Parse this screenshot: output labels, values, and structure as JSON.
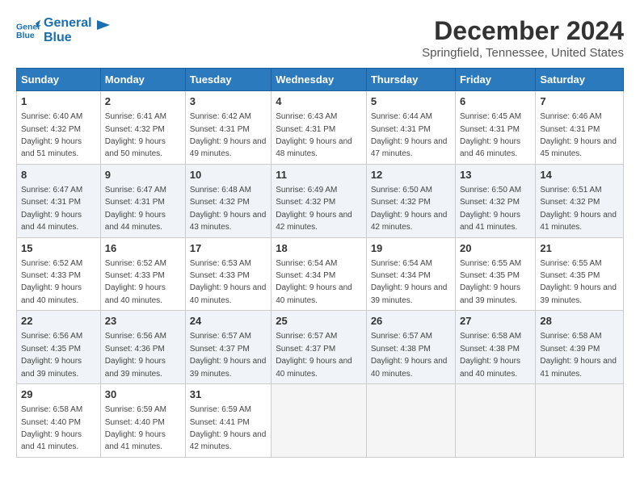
{
  "header": {
    "logo_line1": "General",
    "logo_line2": "Blue",
    "main_title": "December 2024",
    "subtitle": "Springfield, Tennessee, United States"
  },
  "days_of_week": [
    "Sunday",
    "Monday",
    "Tuesday",
    "Wednesday",
    "Thursday",
    "Friday",
    "Saturday"
  ],
  "weeks": [
    [
      {
        "day": "1",
        "sunrise": "6:40 AM",
        "sunset": "4:32 PM",
        "daylight": "9 hours and 51 minutes."
      },
      {
        "day": "2",
        "sunrise": "6:41 AM",
        "sunset": "4:32 PM",
        "daylight": "9 hours and 50 minutes."
      },
      {
        "day": "3",
        "sunrise": "6:42 AM",
        "sunset": "4:31 PM",
        "daylight": "9 hours and 49 minutes."
      },
      {
        "day": "4",
        "sunrise": "6:43 AM",
        "sunset": "4:31 PM",
        "daylight": "9 hours and 48 minutes."
      },
      {
        "day": "5",
        "sunrise": "6:44 AM",
        "sunset": "4:31 PM",
        "daylight": "9 hours and 47 minutes."
      },
      {
        "day": "6",
        "sunrise": "6:45 AM",
        "sunset": "4:31 PM",
        "daylight": "9 hours and 46 minutes."
      },
      {
        "day": "7",
        "sunrise": "6:46 AM",
        "sunset": "4:31 PM",
        "daylight": "9 hours and 45 minutes."
      }
    ],
    [
      {
        "day": "8",
        "sunrise": "6:47 AM",
        "sunset": "4:31 PM",
        "daylight": "9 hours and 44 minutes."
      },
      {
        "day": "9",
        "sunrise": "6:47 AM",
        "sunset": "4:31 PM",
        "daylight": "9 hours and 44 minutes."
      },
      {
        "day": "10",
        "sunrise": "6:48 AM",
        "sunset": "4:32 PM",
        "daylight": "9 hours and 43 minutes."
      },
      {
        "day": "11",
        "sunrise": "6:49 AM",
        "sunset": "4:32 PM",
        "daylight": "9 hours and 42 minutes."
      },
      {
        "day": "12",
        "sunrise": "6:50 AM",
        "sunset": "4:32 PM",
        "daylight": "9 hours and 42 minutes."
      },
      {
        "day": "13",
        "sunrise": "6:50 AM",
        "sunset": "4:32 PM",
        "daylight": "9 hours and 41 minutes."
      },
      {
        "day": "14",
        "sunrise": "6:51 AM",
        "sunset": "4:32 PM",
        "daylight": "9 hours and 41 minutes."
      }
    ],
    [
      {
        "day": "15",
        "sunrise": "6:52 AM",
        "sunset": "4:33 PM",
        "daylight": "9 hours and 40 minutes."
      },
      {
        "day": "16",
        "sunrise": "6:52 AM",
        "sunset": "4:33 PM",
        "daylight": "9 hours and 40 minutes."
      },
      {
        "day": "17",
        "sunrise": "6:53 AM",
        "sunset": "4:33 PM",
        "daylight": "9 hours and 40 minutes."
      },
      {
        "day": "18",
        "sunrise": "6:54 AM",
        "sunset": "4:34 PM",
        "daylight": "9 hours and 40 minutes."
      },
      {
        "day": "19",
        "sunrise": "6:54 AM",
        "sunset": "4:34 PM",
        "daylight": "9 hours and 39 minutes."
      },
      {
        "day": "20",
        "sunrise": "6:55 AM",
        "sunset": "4:35 PM",
        "daylight": "9 hours and 39 minutes."
      },
      {
        "day": "21",
        "sunrise": "6:55 AM",
        "sunset": "4:35 PM",
        "daylight": "9 hours and 39 minutes."
      }
    ],
    [
      {
        "day": "22",
        "sunrise": "6:56 AM",
        "sunset": "4:35 PM",
        "daylight": "9 hours and 39 minutes."
      },
      {
        "day": "23",
        "sunrise": "6:56 AM",
        "sunset": "4:36 PM",
        "daylight": "9 hours and 39 minutes."
      },
      {
        "day": "24",
        "sunrise": "6:57 AM",
        "sunset": "4:37 PM",
        "daylight": "9 hours and 39 minutes."
      },
      {
        "day": "25",
        "sunrise": "6:57 AM",
        "sunset": "4:37 PM",
        "daylight": "9 hours and 40 minutes."
      },
      {
        "day": "26",
        "sunrise": "6:57 AM",
        "sunset": "4:38 PM",
        "daylight": "9 hours and 40 minutes."
      },
      {
        "day": "27",
        "sunrise": "6:58 AM",
        "sunset": "4:38 PM",
        "daylight": "9 hours and 40 minutes."
      },
      {
        "day": "28",
        "sunrise": "6:58 AM",
        "sunset": "4:39 PM",
        "daylight": "9 hours and 41 minutes."
      }
    ],
    [
      {
        "day": "29",
        "sunrise": "6:58 AM",
        "sunset": "4:40 PM",
        "daylight": "9 hours and 41 minutes."
      },
      {
        "day": "30",
        "sunrise": "6:59 AM",
        "sunset": "4:40 PM",
        "daylight": "9 hours and 41 minutes."
      },
      {
        "day": "31",
        "sunrise": "6:59 AM",
        "sunset": "4:41 PM",
        "daylight": "9 hours and 42 minutes."
      },
      null,
      null,
      null,
      null
    ]
  ],
  "labels": {
    "sunrise": "Sunrise:",
    "sunset": "Sunset:",
    "daylight": "Daylight:"
  }
}
